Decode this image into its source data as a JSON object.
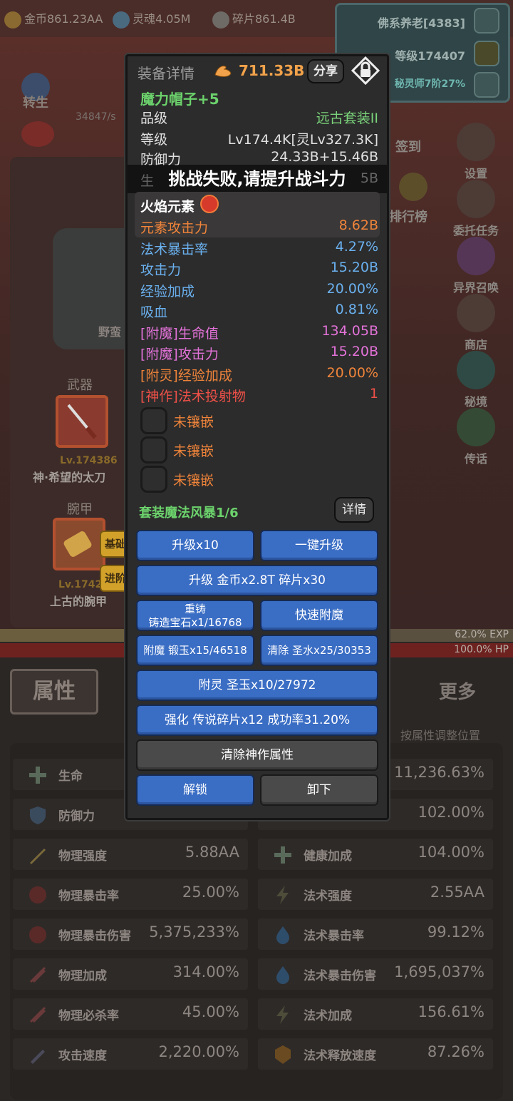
{
  "resources": [
    {
      "icon": "gold-coin-icon",
      "label": "金币861.23AA"
    },
    {
      "icon": "soul-icon",
      "label": "灵魂4.05M"
    },
    {
      "icon": "shard-icon",
      "label": "碎片861.4B"
    }
  ],
  "player": {
    "name": "佛系养老[4383]",
    "level": "等级174407",
    "class": "秘灵师7阶27%"
  },
  "left_menu": {
    "rebirth": "转生",
    "dps": "34847/s"
  },
  "right_menu": [
    {
      "icon": "gear-icon",
      "label": "设置"
    },
    {
      "icon": "quest-icon",
      "label": "委托任务"
    },
    {
      "icon": "portal-icon",
      "label": "异界召唤"
    },
    {
      "icon": "shop-icon",
      "label": "商店"
    },
    {
      "icon": "realm-icon",
      "label": "秘境"
    },
    {
      "icon": "horn-icon",
      "label": "传话"
    }
  ],
  "mid_menu": [
    {
      "label": "签到"
    },
    {
      "label": "排行榜"
    }
  ],
  "character": {
    "name_partial": "野蛮",
    "weapon_label": "武器",
    "weapon_level": "Lv.174386",
    "weapon_name": "神·希望的太刀",
    "bracer_label": "腕甲",
    "bracer_level": "Lv.1742",
    "bracer_name": "上古的腕甲",
    "tag_basic": "基础",
    "tag_advanced": "进阶"
  },
  "bars": {
    "exp": "62.0% EXP",
    "hp": "100.0% HP",
    "exp_ratio": 0.62,
    "hp_ratio": 1.0
  },
  "bottom_tabs": {
    "attributes": "属性",
    "more": "更多",
    "sort_hint": "按属性调整位置"
  },
  "stats_left": [
    {
      "icon": "cross-icon",
      "name": "生命",
      "value": ""
    },
    {
      "icon": "shield-icon",
      "name": "防御力",
      "value": ""
    },
    {
      "icon": "sword-icon",
      "name": "物理强度",
      "value": "5.88AA"
    },
    {
      "icon": "claw-icon",
      "name": "物理暴击率",
      "value": "25.00%"
    },
    {
      "icon": "claw-icon",
      "name": "物理暴击伤害",
      "value": "5,375,233%"
    },
    {
      "icon": "slash-icon",
      "name": "物理加成",
      "value": "314.00%"
    },
    {
      "icon": "slash-icon",
      "name": "物理必杀率",
      "value": "45.00%"
    },
    {
      "icon": "dagger-icon",
      "name": "攻击速度",
      "value": "2,220.00%"
    }
  ],
  "stats_right": [
    {
      "icon": "",
      "name": "",
      "value": "11,236.63%"
    },
    {
      "icon": "drop-icon",
      "name": "",
      "value": "102.00%"
    },
    {
      "icon": "cross-icon",
      "name": "健康加成",
      "value": "104.00%"
    },
    {
      "icon": "lightning-icon",
      "name": "法术强度",
      "value": "2.55AA"
    },
    {
      "icon": "flame-icon",
      "name": "法术暴击率",
      "value": "99.12%"
    },
    {
      "icon": "flame-icon",
      "name": "法术暴击伤害",
      "value": "1,695,037%"
    },
    {
      "icon": "lightning-icon",
      "name": "法术加成",
      "value": "156.61%"
    },
    {
      "icon": "badge-icon",
      "name": "法术释放速度",
      "value": "87.26%"
    }
  ],
  "dialog": {
    "title": "装备详情",
    "power": "711.33B",
    "share": "分享",
    "item_name": "魔力帽子+5",
    "quality_label": "品级",
    "quality_value": "远古套装II",
    "level_label": "等级",
    "level_value": "Lv174.4K[灵Lv327.3K]",
    "defense_label": "防御力",
    "defense_value": "24.33B+15.46B",
    "hp_label_partial": "生",
    "hp_value_partial": "5B",
    "toast": "挑战失败,请提升战斗力",
    "element_title": "火焰元素",
    "attributes": [
      {
        "name": "元素攻击力",
        "value": "8.62B",
        "color": "orange"
      },
      {
        "name": "法术暴击率",
        "value": "4.27%",
        "color": "blue"
      },
      {
        "name": "攻击力",
        "value": "15.20B",
        "color": "blue"
      },
      {
        "name": "经验加成",
        "value": "20.00%",
        "color": "blue"
      },
      {
        "name": "吸血",
        "value": "0.81%",
        "color": "blue"
      },
      {
        "name": "[附魔]生命值",
        "value": "134.05B",
        "color": "pink"
      },
      {
        "name": "[附魔]攻击力",
        "value": "15.20B",
        "color": "pink"
      },
      {
        "name": "[附灵]经验加成",
        "value": "20.00%",
        "color": "orange"
      },
      {
        "name": "[神作]法术投射物",
        "value": "1",
        "color": "red"
      }
    ],
    "sockets": [
      "未镶嵌",
      "未镶嵌",
      "未镶嵌"
    ],
    "set_label": "套装魔法风暴1/6",
    "detail": "详情",
    "buttons": {
      "upgrade10": "升级x10",
      "one_key_upgrade": "一键升级",
      "upgrade_cost": "升级 金币x2.8T 碎片x30",
      "reforge_line1": "重铸",
      "reforge_line2": "铸造宝石x1/16768",
      "quick_enchant": "快速附魔",
      "enchant": "附魔 锻玉x15/46518",
      "clear": "清除 圣水x25/30353",
      "spirit": "附灵 圣玉x10/27972",
      "strengthen": "强化 传说碎片x12 成功率31.20%",
      "clear_divine": "清除神作属性",
      "unlock": "解锁",
      "unequip": "卸下"
    }
  }
}
